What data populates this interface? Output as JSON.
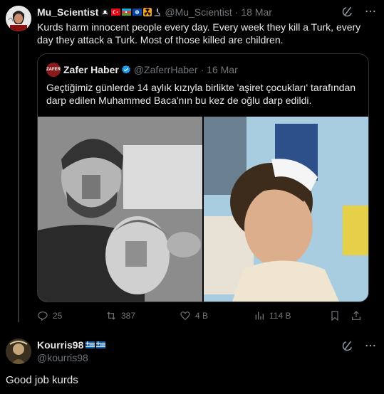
{
  "post": {
    "author_name": "Mu_Scientist",
    "author_flags": [
      "pirate-flag",
      "turkey-flag",
      "azerbaijan-flag",
      "au-flag",
      "radiation-icon",
      "microscope-icon"
    ],
    "handle": "@Mu_Scientist",
    "separator": "·",
    "time": "18 Mar",
    "text": "Kurds harm innocent people every day. Every week they kill a Turk, every day they attack a Turk. Most of those killed are children."
  },
  "quote": {
    "author_name": "Zafer Haber",
    "handle": "@ZaferrHaber",
    "separator": "·",
    "time": "16 Mar",
    "avatar_text": "ZAFER",
    "text": "Geçtiğimiz günlerde 14 aylık kızıyla birlikte 'aşiret çocukları' tarafından darp edilen Muhammed Baca'nın bu kez de oğlu darp edildi."
  },
  "actions": {
    "replies": "25",
    "reposts": "387",
    "likes": "4 B",
    "views": "114 B"
  },
  "reply": {
    "author_name": "Kourris98",
    "handle": "@kourris98",
    "text": "Good job kurds"
  },
  "colors": {
    "background": "#000000",
    "text": "#e7e9ea",
    "muted": "#71767b",
    "border": "#2f3336",
    "verified": "#1d9bf0"
  }
}
